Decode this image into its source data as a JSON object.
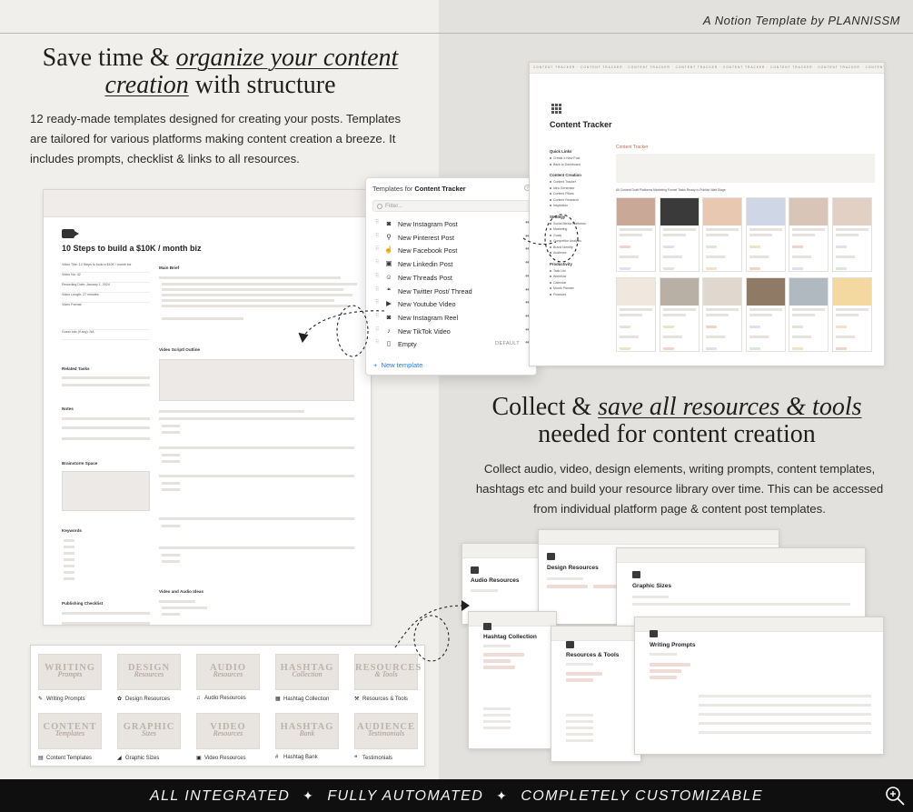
{
  "brand": "A Notion Template by PLANNISSM",
  "section1": {
    "headline_pre": "Save time & ",
    "headline_em1": "organize your content",
    "headline_em2": "creation",
    "headline_post": " with structure",
    "body": "12 ready-made templates designed for creating your posts. Templates are tailored for various platforms making content creation a breeze. It includes prompts, checklist & links to all resources."
  },
  "section2": {
    "headline_pre": "Collect & ",
    "headline_em": "save all resources & tools",
    "headline_line2": "needed for content creation",
    "body": "Collect audio, video, design elements, writing prompts, content templates, hashtags etc and build your resource library over time. This can be accessed from individual platform page & content post templates."
  },
  "post_page": {
    "title": "10 Steps to build a $10K / month biz",
    "main_brief": "Main Brief",
    "video_script": "Video Script/ Outline",
    "related_tasks": "Related Tasks",
    "notes": "Notes",
    "brainstorm": "Brainstorm Space",
    "keywords": "Keywords",
    "publishing_checklist": "Publishing Checklist",
    "video_audio_ideas": "Video and Audio Ideas",
    "props": [
      "Video Title: 10 Steps to build a $10K / month biz",
      "Video No: 42",
      "Recording Date: January 1, 2024",
      "Video Length: 27 minutes",
      "Video Format",
      "Guest Info (if any): NA"
    ]
  },
  "popover": {
    "heading_prefix": "Templates for ",
    "heading_db": "Content Tracker",
    "filter_placeholder": "Filter...",
    "items": [
      {
        "label": "New Instagram Post",
        "icon": "camera-icon",
        "glyph": "◙"
      },
      {
        "label": "New Pinterest Post",
        "icon": "pin-icon",
        "glyph": "⚲"
      },
      {
        "label": "New Facebook Post",
        "icon": "thumbs-up-icon",
        "glyph": "☝"
      },
      {
        "label": "New Linkedin Post",
        "icon": "id-card-icon",
        "glyph": "▣"
      },
      {
        "label": "New Threads Post",
        "icon": "robot-icon",
        "glyph": "☺"
      },
      {
        "label": "New Twitter Post/ Thread",
        "icon": "chat-bubbles-icon",
        "glyph": "❝"
      },
      {
        "label": "New Youtube Video",
        "icon": "video-icon",
        "glyph": "▶"
      },
      {
        "label": "New Instagram Reel",
        "icon": "camera-icon",
        "glyph": "◙"
      },
      {
        "label": "New TikTok Video",
        "icon": "music-note-icon",
        "glyph": "♪"
      },
      {
        "label": "Empty",
        "icon": "page-icon",
        "glyph": "▯",
        "badge": "DEFAULT"
      }
    ],
    "new_template": "New template"
  },
  "tracker": {
    "title": "Content Tracker",
    "main_title": "Content Tracker",
    "banner": "· CONTENT TRACKER · CONTENT TRACKER · CONTENT TRACKER · CONTENT TRACKER · CONTENT TRACKER · CONTENT TRACKER · CONTENT TRACKER · CONTENT TRACKER ·",
    "tabs": "All Content   Draft   Platforms   Marketing Funnel   Tasks   Ready to Publish   Wait Stage",
    "sidebar": [
      {
        "section": "Quick Links",
        "items": [
          "Create a New Post",
          "Back to Dashboard"
        ]
      },
      {
        "section": "Content Creation",
        "items": [
          "Content Tracker",
          "Idea Generator",
          "Content Pillars",
          "Content Research",
          "Inspiration"
        ]
      },
      {
        "section": "Strategy",
        "items": [
          "Social Media Platforms",
          "Marketing",
          "Goals",
          "Competitor Analysis",
          "Brand Identity",
          "Audience"
        ]
      },
      {
        "section": "Productivity",
        "items": [
          "Task List",
          "Workflow",
          "Calendar",
          "Month Planner",
          "Finances"
        ]
      }
    ],
    "card_colors": [
      "#c9a898",
      "#3a3a3a",
      "#e8c8b0",
      "#cfd7e6",
      "#d9c5b8",
      "#e2d0c4",
      "#f0e8df",
      "#b8b0a5",
      "#e0d8ce",
      "#8f7a66",
      "#b0b8c0",
      "#f3d9a0",
      "#ddd6cc",
      "#c4b6a8"
    ]
  },
  "tiles": [
    {
      "word": "WRITING",
      "script": "Prompts",
      "icon": "pencil-icon",
      "glyph": "✎",
      "label": "Writing Prompts"
    },
    {
      "word": "DESIGN",
      "script": "Resources",
      "icon": "palette-icon",
      "glyph": "✿",
      "label": "Design Resources"
    },
    {
      "word": "AUDIO",
      "script": "Resources",
      "icon": "headphones-icon",
      "glyph": "♫",
      "label": "Audio Resources"
    },
    {
      "word": "HASHTAG",
      "script": "Collection",
      "icon": "grid-icon",
      "glyph": "▦",
      "label": "Hashtag Collection"
    },
    {
      "word": "RESOURCES",
      "script": "& Tools",
      "icon": "tools-icon",
      "glyph": "⚒",
      "label": "Resources & Tools"
    },
    {
      "word": "CONTENT",
      "script": "Templates",
      "icon": "template-icon",
      "glyph": "▤",
      "label": "Content Templates"
    },
    {
      "word": "GRAPHIC",
      "script": "Sizes",
      "icon": "ruler-icon",
      "glyph": "◢",
      "label": "Graphic Sizes"
    },
    {
      "word": "VIDEO",
      "script": "Resources",
      "icon": "film-icon",
      "glyph": "▣",
      "label": "Video Resources"
    },
    {
      "word": "HASHTAG",
      "script": "Bank",
      "icon": "hashtag-icon",
      "glyph": "#",
      "label": "Hashtag Bank"
    },
    {
      "word": "AUDIENCE",
      "script": "Testimonials",
      "icon": "quote-icon",
      "glyph": "❝",
      "label": "Testimonials"
    }
  ],
  "resource_pages": [
    "Audio Resources",
    "Design Resources",
    "Graphic Sizes",
    "Hashtag Collection",
    "Resources & Tools",
    "Writing Prompts"
  ],
  "bottom_bar": {
    "item1": "ALL INTEGRATED",
    "item2": "FULLY AUTOMATED",
    "item3": "COMPLETELY CUSTOMIZABLE",
    "separator": "✦"
  }
}
